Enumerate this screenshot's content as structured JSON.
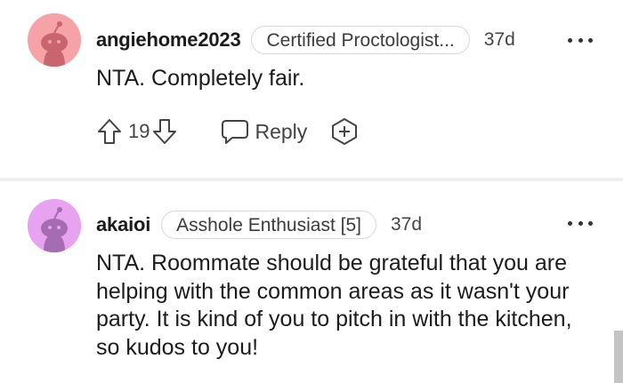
{
  "comments": [
    {
      "username": "angiehome2023",
      "flair": "Certified Proctologist...",
      "age": "37d",
      "text": "NTA. Completely fair.",
      "votes": "19",
      "reply_label": "Reply",
      "avatar_color": "#f5a3a7"
    },
    {
      "username": "akaioi",
      "flair": "Asshole Enthusiast [5]",
      "age": "37d",
      "text": "NTA. Roommate should be grateful that you are helping with the common areas as it wasn't your party. It is kind of you to pitch in with the kitchen, so kudos to you!",
      "avatar_color": "#e7a3f0"
    }
  ],
  "icons": {
    "upvote": "arrow-up-icon",
    "downvote": "arrow-down-icon",
    "reply": "speech-bubble-icon",
    "award": "award-plus-icon",
    "more": "more-dots-icon"
  }
}
